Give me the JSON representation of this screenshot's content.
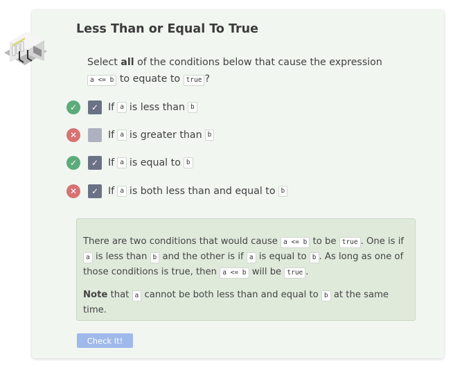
{
  "page": {
    "title": "Less Than or Equal To True"
  },
  "question": {
    "part1": "Select",
    "bold": "all",
    "part2": "of the conditions below that cause the expression",
    "code1": "a <= b",
    "part3": "to equate to",
    "code2": "true",
    "part4": "?"
  },
  "options": [
    {
      "status": "correct",
      "checked": true,
      "text1": "If",
      "code1": "a",
      "text2": "is less than",
      "code2": "b"
    },
    {
      "status": "wrong",
      "checked": false,
      "text1": "If",
      "code1": "a",
      "text2": "is greater than",
      "code2": "b"
    },
    {
      "status": "correct",
      "checked": true,
      "text1": "If",
      "code1": "a",
      "text2": "is equal to",
      "code2": "b"
    },
    {
      "status": "wrong",
      "checked": true,
      "text1": "If",
      "code1": "a",
      "text2": "is both less than and equal to",
      "code2": "b"
    }
  ],
  "icons": {
    "correct": "check-circle-icon",
    "wrong": "x-circle-icon",
    "checkbox_mark": "checkmark-icon"
  },
  "colors": {
    "correct": "#5cab7a",
    "wrong": "#d87272",
    "checkbox_checked": "#6b7285",
    "checkbox_unchecked": "#aeb2bf",
    "button": "#9fb9ea"
  },
  "explanation": {
    "t1": "There are two conditions that would cause",
    "c1": "a <= b",
    "t2": "to be",
    "c2": "true",
    "t3": ". One is if",
    "c3": "a",
    "t4": "is less than",
    "c4": "b",
    "t5": "and the other is if",
    "c5": "a",
    "t6": "is equal to",
    "c6": "b",
    "t7": ". As long as one of those conditions is true, then",
    "c7": "a <= b",
    "t8": "will be",
    "c8": "true",
    "t9": ".",
    "note_bold": "Note",
    "n1": "that",
    "nc1": "a",
    "n2": "cannot be both less than and equal to",
    "nc2": "b",
    "n3": "at the same time."
  },
  "button": {
    "label": "Check It!"
  }
}
